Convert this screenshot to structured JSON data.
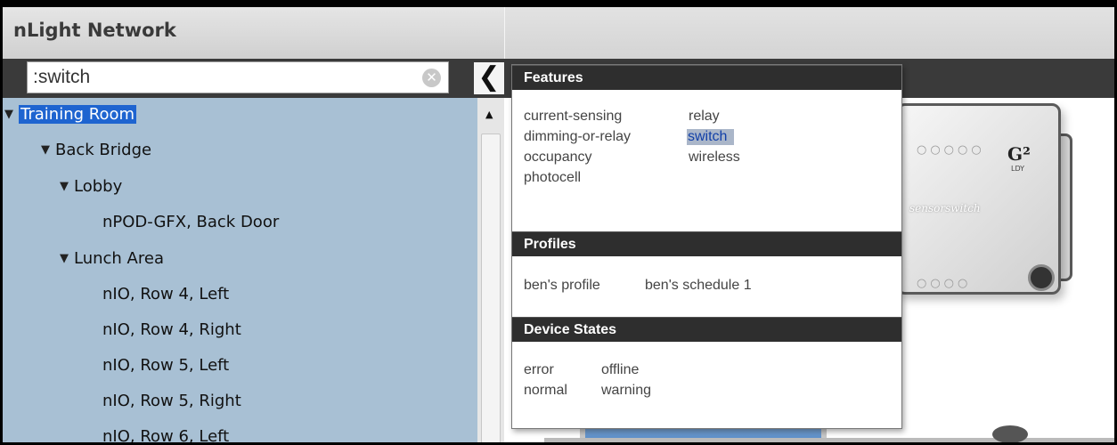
{
  "app": {
    "title": "nLight Network"
  },
  "search": {
    "value": ":switch",
    "clear_icon": "clear-circle-icon"
  },
  "toolbar": {
    "collapse_icon": "chevron-left-icon",
    "collapse_glyph": "❮"
  },
  "tree": {
    "items": [
      {
        "label": "Training Room",
        "expanded": true,
        "selected": true
      },
      {
        "label": "Back Bridge",
        "expanded": true
      },
      {
        "label": "Lobby",
        "expanded": true
      },
      {
        "label": "nPOD-GFX, Back Door"
      },
      {
        "label": "Lunch Area",
        "expanded": true
      },
      {
        "label": "nIO, Row 4, Left"
      },
      {
        "label": "nIO, Row 4, Right"
      },
      {
        "label": "nIO, Row 5, Left"
      },
      {
        "label": "nIO, Row 5, Right"
      },
      {
        "label": "nIO, Row 6, Left"
      }
    ],
    "expand_glyph": "▼"
  },
  "scrollbar": {
    "up_glyph": "▲"
  },
  "device_image": {
    "badge": "G²",
    "badge_sub": "LDY",
    "brand": "sensorswitch"
  },
  "filter_popup": {
    "sections": [
      {
        "title": "Features",
        "items": [
          "current-sensing",
          "relay",
          "dimming-or-relay",
          "switch",
          "occupancy",
          "wireless",
          "photocell"
        ],
        "selected": "switch"
      },
      {
        "title": "Profiles",
        "items": [
          "ben's profile",
          "ben's schedule 1"
        ]
      },
      {
        "title": "Device States",
        "items": [
          "error",
          "offline",
          "normal",
          "warning"
        ]
      }
    ]
  },
  "colors": {
    "tree_background": "#a8c0d4",
    "selection": "#1e64d0",
    "toolbar_dark": "#3a3a3a",
    "popup_header": "#2e2e2e",
    "feature_selected": "#aab6c9"
  }
}
